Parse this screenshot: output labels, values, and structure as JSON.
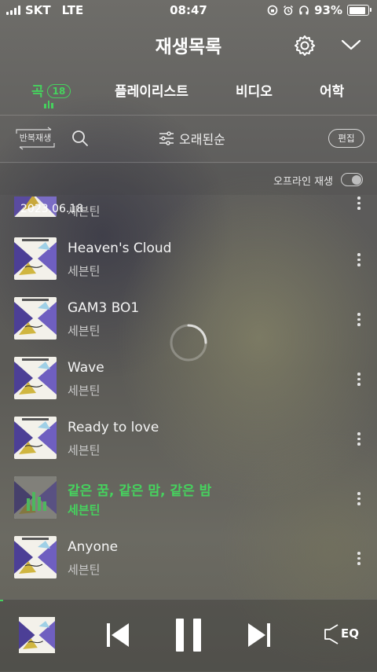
{
  "status": {
    "carrier": "SKT",
    "network": "LTE",
    "time": "08:47",
    "battery": "93%"
  },
  "header": {
    "title": "재생목록",
    "settings_icon": "gear-icon",
    "collapse_icon": "chevron-down-icon"
  },
  "tabs": [
    {
      "label": "곡",
      "badge": "18",
      "active": true
    },
    {
      "label": "플레이리스트"
    },
    {
      "label": "비디오"
    },
    {
      "label": "어학"
    }
  ],
  "toolbar": {
    "repeat_label": "반복재생",
    "sort_label": "오래된순",
    "edit_label": "편집"
  },
  "offline": {
    "label": "오프라인 재생",
    "enabled": false
  },
  "partial_row": {
    "date": "2023.06.18",
    "artist": "세븐틴"
  },
  "songs": [
    {
      "title": "Heaven's Cloud",
      "artist": "세븐틴"
    },
    {
      "title": "GAM3 BO1",
      "artist": "세븐틴"
    },
    {
      "title": "Wave",
      "artist": "세븐틴"
    },
    {
      "title": "Ready to love",
      "artist": "세븐틴"
    },
    {
      "title": "같은 꿈, 같은 맘, 같은 밤",
      "artist": "세븐틴",
      "playing": true
    },
    {
      "title": "Anyone",
      "artist": "세븐틴"
    }
  ],
  "player": {
    "eq_label": "EQ",
    "state": "playing"
  },
  "colors": {
    "accent": "#46d25e"
  }
}
